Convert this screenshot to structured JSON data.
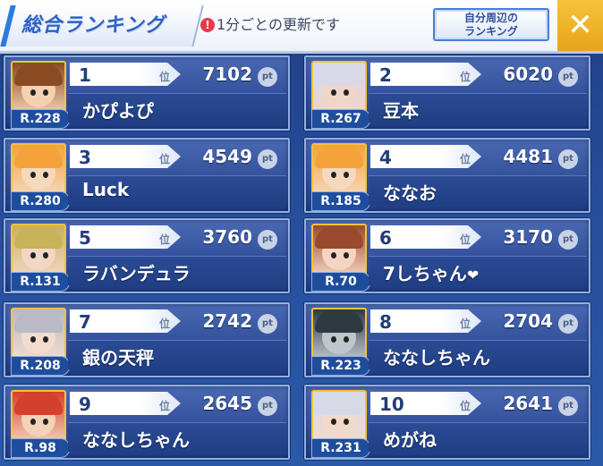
{
  "header": {
    "title": "総合ランキング",
    "notice": "1分ごとの更新です",
    "notice_icon": "!",
    "nearby_button_label": "自分周辺の\nランキング",
    "close_label": "✕"
  },
  "rank_suffix": "位",
  "pt_label": "pt",
  "entries": [
    {
      "rank": "1",
      "score": "7102",
      "name": "かぴよぴ",
      "level": "R.228",
      "hair": "#8a4b22",
      "skin": "#f4d1b1"
    },
    {
      "rank": "2",
      "score": "6020",
      "name": "豆本",
      "level": "R.267",
      "hair": "#d8d8e6",
      "skin": "#f0d6c7"
    },
    {
      "rank": "3",
      "score": "4549",
      "name": "Luck",
      "level": "R.280",
      "hair": "#f3a33a",
      "skin": "#f6d8bf"
    },
    {
      "rank": "4",
      "score": "4481",
      "name": "ななお",
      "level": "R.185",
      "hair": "#f3a33a",
      "skin": "#f6d8bf"
    },
    {
      "rank": "5",
      "score": "3760",
      "name": "ラバンデュラ",
      "level": "R.131",
      "hair": "#c8b25a",
      "skin": "#f2d7c4"
    },
    {
      "rank": "6",
      "score": "3170",
      "name": "7しちゃん",
      "level": "R.70",
      "hair": "#9a4a2c",
      "skin": "#f5d5c1",
      "heart": "❤"
    },
    {
      "rank": "7",
      "score": "2742",
      "name": "銀の天秤",
      "level": "R.208",
      "hair": "#b9b9c8",
      "skin": "#f3dccd"
    },
    {
      "rank": "8",
      "score": "2704",
      "name": "ななしちゃん",
      "level": "R.223",
      "hair": "#2d3b3f",
      "skin": "#bfc7cc"
    },
    {
      "rank": "9",
      "score": "2645",
      "name": "ななしちゃん",
      "level": "R.98",
      "hair": "#d4402e",
      "skin": "#f3d3b8"
    },
    {
      "rank": "10",
      "score": "2641",
      "name": "めがね",
      "level": "R.231",
      "hair": "#d6d9e6",
      "skin": "#f2dacb"
    }
  ]
}
